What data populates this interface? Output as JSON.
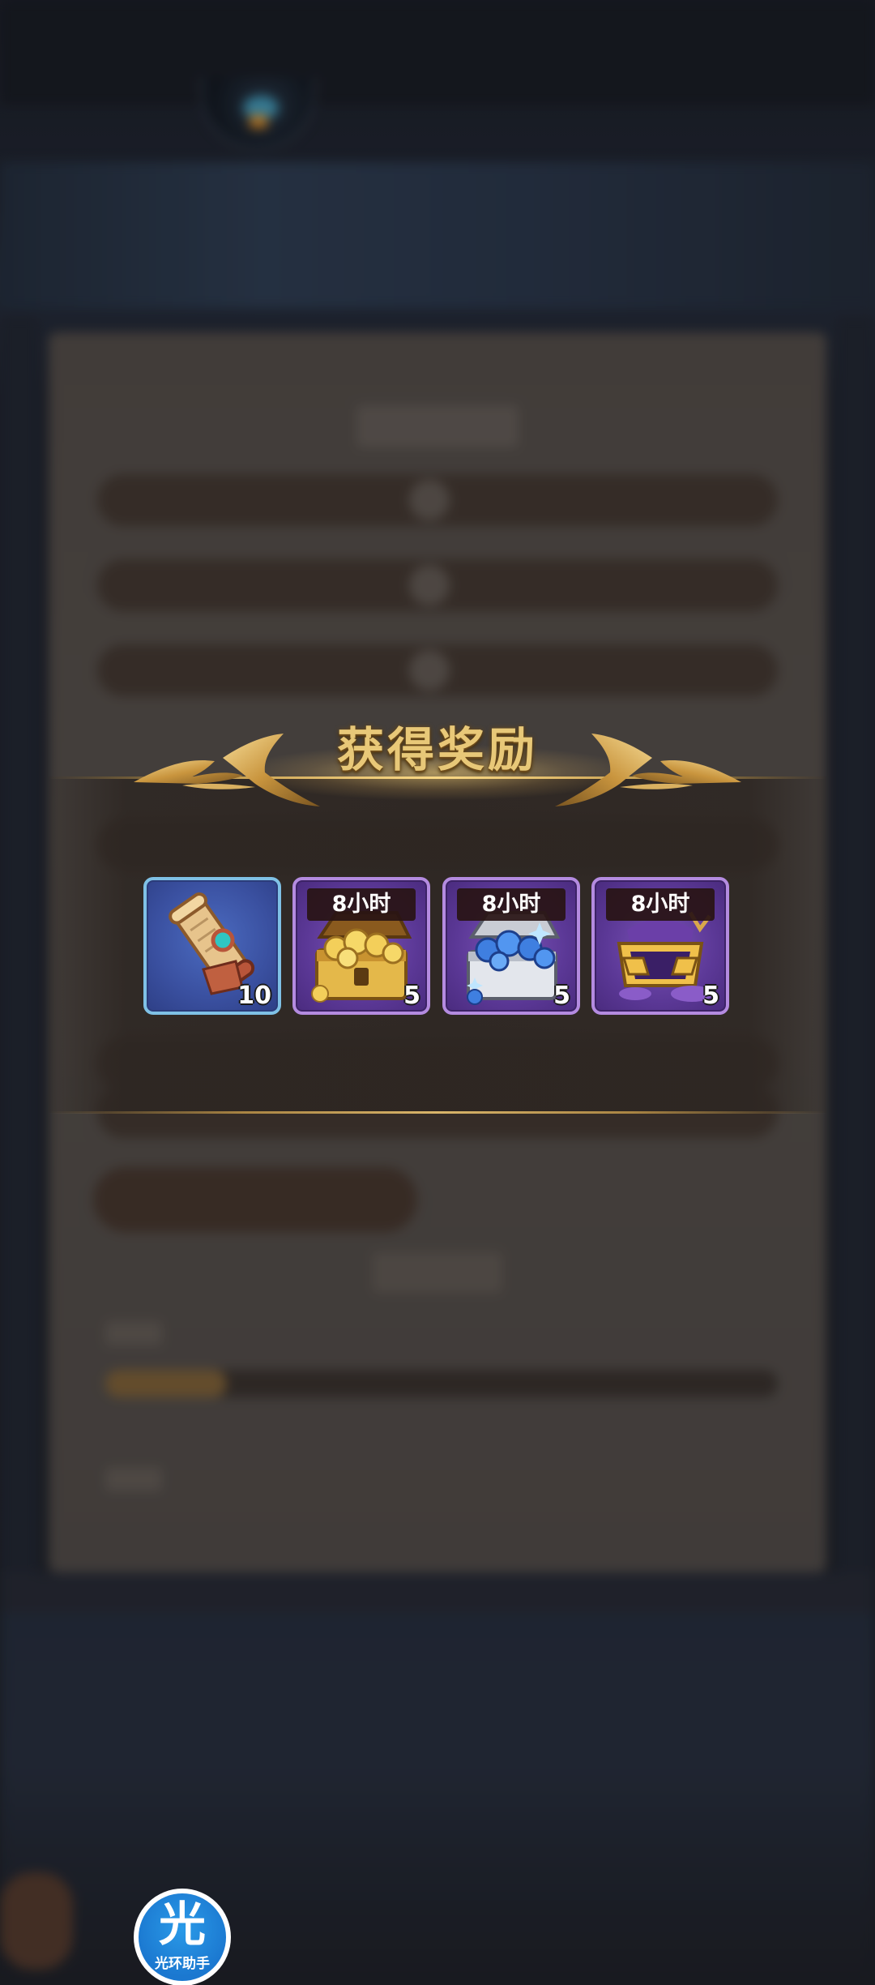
{
  "popup": {
    "title": "获得奖励"
  },
  "rewards": [
    {
      "name": "scroll",
      "label": "",
      "count": "10",
      "rarity": "blue",
      "icon": "scroll-icon"
    },
    {
      "name": "gold-chest",
      "label": "8小时",
      "count": "5",
      "rarity": "purple",
      "icon": "gold-chest-icon"
    },
    {
      "name": "hero-exp-chest",
      "label": "8小时",
      "count": "5",
      "rarity": "purple",
      "icon": "blue-orb-chest-icon"
    },
    {
      "name": "dust-chest",
      "label": "8小时",
      "count": "5",
      "rarity": "purple",
      "icon": "purple-dust-chest-icon"
    }
  ],
  "assistant": {
    "glyph": "光",
    "label": "光环助手",
    "icon": "guanghuan-assistant-icon"
  },
  "colors": {
    "title_gold": "#e8c878",
    "rarity_blue": "#7fc1e6",
    "rarity_purple": "#b48be0",
    "assistant_blue": "#1b78d0"
  }
}
